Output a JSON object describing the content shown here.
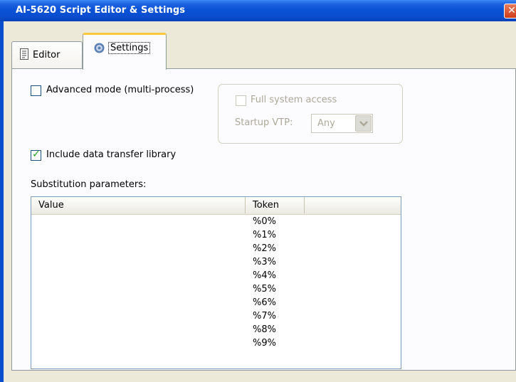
{
  "window": {
    "title": "AI-5620 Script Editor & Settings",
    "close_glyph": "✕"
  },
  "tabs": [
    {
      "label": "Editor",
      "icon": "document-icon",
      "active": false
    },
    {
      "label": "Settings",
      "icon": "gear-icon",
      "active": true
    }
  ],
  "settings": {
    "advanced_mode": {
      "label": "Advanced mode (multi-process)",
      "checked": false
    },
    "full_system_access": {
      "label": "Full system access",
      "checked": false,
      "enabled": false
    },
    "startup_vtp": {
      "label": "Startup VTP:",
      "value": "Any",
      "enabled": false
    },
    "include_library": {
      "label": "Include data transfer library",
      "checked": true
    },
    "substitution_label": "Substitution parameters:"
  },
  "table": {
    "columns": [
      "Value",
      "Token"
    ],
    "rows": [
      {
        "value": "",
        "token": "%0%"
      },
      {
        "value": "",
        "token": "%1%"
      },
      {
        "value": "",
        "token": "%2%"
      },
      {
        "value": "",
        "token": "%3%"
      },
      {
        "value": "",
        "token": "%4%"
      },
      {
        "value": "",
        "token": "%5%"
      },
      {
        "value": "",
        "token": "%6%"
      },
      {
        "value": "",
        "token": "%7%"
      },
      {
        "value": "",
        "token": "%8%"
      },
      {
        "value": "",
        "token": "%9%"
      }
    ]
  },
  "colors": {
    "titlebar": "#0a4ed0",
    "tab_highlight": "#ffc83c",
    "checkmark": "#21a121"
  }
}
